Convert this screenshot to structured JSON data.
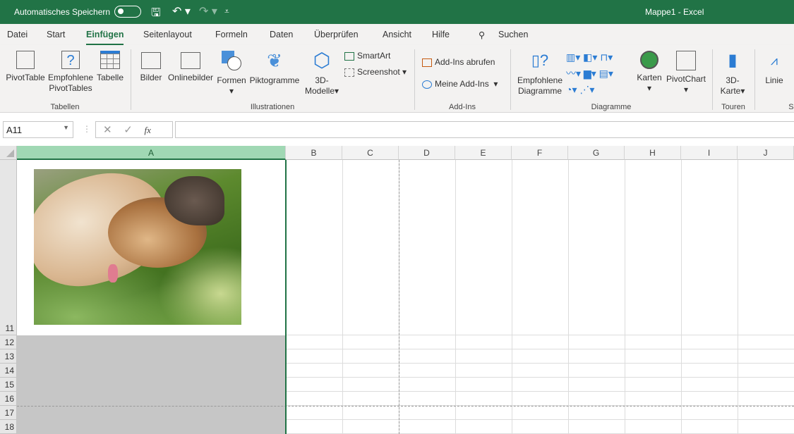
{
  "titlebar": {
    "autosave_label": "Automatisches Speichern",
    "title": "Mappe1  -  Excel",
    "icons": [
      "save-icon",
      "undo-icon",
      "redo-icon",
      "customize-icon"
    ]
  },
  "tabs": [
    "Datei",
    "Start",
    "Einfügen",
    "Seitenlayout",
    "Formeln",
    "Daten",
    "Überprüfen",
    "Ansicht",
    "Hilfe"
  ],
  "active_tab": "Einfügen",
  "search_label": "Suchen",
  "ribbon": {
    "tabellen": {
      "label": "Tabellen",
      "pivottable": "PivotTable",
      "empf1": "Empfohlene",
      "empf2": "PivotTables",
      "tabelle": "Tabelle"
    },
    "illustrationen": {
      "label": "Illustrationen",
      "bilder": "Bilder",
      "onlinebilder": "Onlinebilder",
      "formen": "Formen",
      "piktogramme": "Piktogramme",
      "modelle1": "3D-",
      "modelle2": "Modelle",
      "smartart": "SmartArt",
      "screenshot": "Screenshot"
    },
    "addins": {
      "label": "Add-Ins",
      "abrufen": "Add-Ins abrufen",
      "meine": "Meine Add-Ins"
    },
    "diagramme": {
      "label": "Diagramme",
      "empf1": "Empfohlene",
      "empf2": "Diagramme",
      "karten": "Karten",
      "pivotchart": "PivotChart"
    },
    "touren": {
      "label": "Touren",
      "karte1": "3D-",
      "karte2": "Karte"
    },
    "sparklines": {
      "label": "Sp",
      "linie": "Linie"
    }
  },
  "formula_bar": {
    "name_box": "A11",
    "fx": "fx",
    "formula": ""
  },
  "columns": [
    "A",
    "B",
    "C",
    "D",
    "E",
    "F",
    "G",
    "H",
    "I",
    "J"
  ],
  "rows": [
    "11",
    "12",
    "13",
    "14",
    "15",
    "16",
    "17",
    "18"
  ],
  "colors": {
    "accent": "#217346",
    "selected_header": "#a0d8b4"
  }
}
